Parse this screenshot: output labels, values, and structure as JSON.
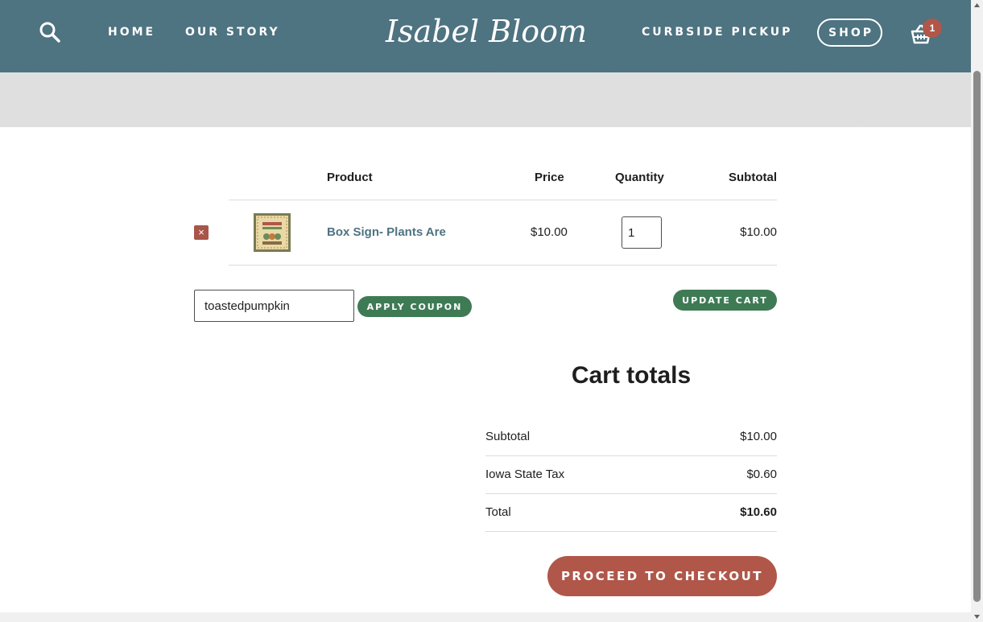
{
  "header": {
    "nav": {
      "home": "HOME",
      "our_story": "OUR STORY",
      "curbside": "CURBSIDE PICKUP",
      "shop": "SHOP"
    },
    "logo_text": "Isabel Bloom",
    "cart_count": "1",
    "icons": {
      "search": "search-icon",
      "cart": "basket-icon"
    },
    "colors": {
      "header_bg": "#4e7381",
      "banner_bg": "#dfdfdf"
    }
  },
  "cart_table": {
    "columns": {
      "product": "Product",
      "price": "Price",
      "quantity": "Quantity",
      "subtotal": "Subtotal"
    },
    "items": [
      {
        "remove_icon": "×",
        "name": "Box Sign- Plants Are",
        "price": "$10.00",
        "quantity": "1",
        "subtotal": "$10.00"
      }
    ]
  },
  "coupon": {
    "value": "toastedpumpkin",
    "apply_label": "APPLY COUPON"
  },
  "update_cart_label": "UPDATE CART",
  "totals": {
    "title": "Cart totals",
    "subtotal_label": "Subtotal",
    "subtotal_value": "$10.00",
    "tax_label": "Iowa State Tax",
    "tax_value": "$0.60",
    "total_label": "Total",
    "total_value": "$10.60"
  },
  "checkout_label": "PROCEED TO CHECKOUT",
  "colors": {
    "accent_green": "#3e7b55",
    "accent_red": "#b0574a",
    "link_blue": "#4e7381"
  }
}
